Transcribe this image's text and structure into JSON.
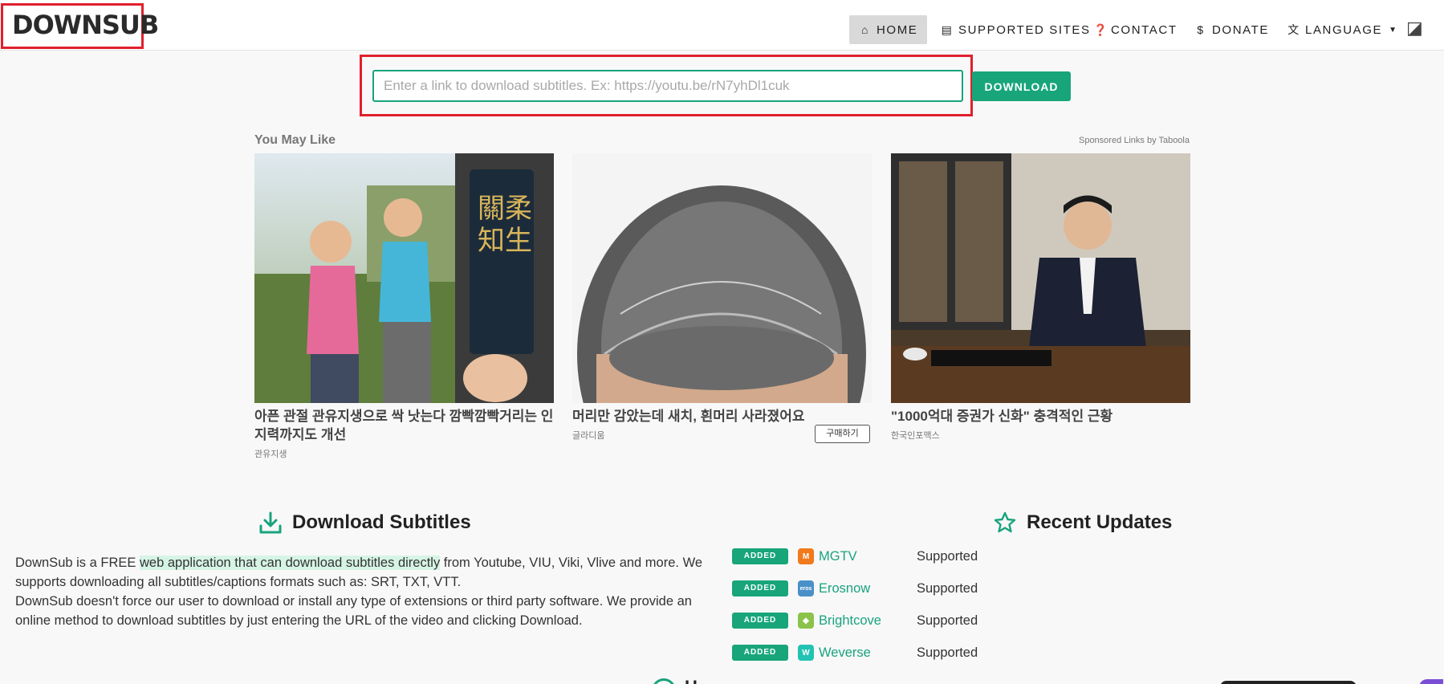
{
  "header": {
    "logo": "DOWNSUB",
    "nav": [
      {
        "label": "HOME",
        "icon": "home-icon",
        "active": true
      },
      {
        "label": "SUPPORTED SITES",
        "icon": "list-icon"
      },
      {
        "label": "CONTACT",
        "icon": "question-icon"
      },
      {
        "label": "DONATE",
        "icon": "dollar-icon"
      },
      {
        "label": "LANGUAGE",
        "icon": "translate-icon"
      }
    ],
    "theme_icon": "theme-toggle-icon"
  },
  "search": {
    "placeholder": "Enter a link to download subtitles. Ex: https://youtu.be/rN7yhDl1cuk",
    "value": "",
    "button": "DOWNLOAD"
  },
  "ads": {
    "title": "You May Like",
    "sponsor": "Sponsored Links by Taboola",
    "items": [
      {
        "headline": "아픈 관절 관유지생으로 싹 낫는다 깜빡깜빡거리는 인지력까지도 개선",
        "source": "관유지생"
      },
      {
        "headline": "머리만 감았는데 새치, 흰머리 사라졌어요",
        "source": "글라디움",
        "button": "구매하기"
      },
      {
        "headline": "\"1000억대 증권가 신화\" 충격적인 근황",
        "source": "한국인포맥스"
      }
    ]
  },
  "download_section": {
    "title": "Download Subtitles",
    "desc_part1": "DownSub is a FREE ",
    "desc_highlight": "web application that can download subtitles directly",
    "desc_part2": " from Youtube, VIU, Viki, Vlive and more. We supports downloading all subtitles/captions formats such as: SRT, TXT, VTT.",
    "desc_line2": "DownSub doesn't force our user to download or install any type of extensions or third party software. We provide an online method to download subtitles by just entering the URL of the video and clicking Download."
  },
  "updates": {
    "title": "Recent Updates",
    "items": [
      {
        "badge": "ADDED",
        "site": "MGTV",
        "status": "Supported",
        "icon_color": "#f07a1c",
        "icon_text": "M"
      },
      {
        "badge": "ADDED",
        "site": "Erosnow",
        "status": "Supported",
        "icon_color": "#4a90c8",
        "icon_text": "eros"
      },
      {
        "badge": "ADDED",
        "site": "Brightcove",
        "status": "Supported",
        "icon_color": "#8bc34a",
        "icon_text": "◆"
      },
      {
        "badge": "ADDED",
        "site": "Weverse",
        "status": "Supported",
        "icon_color": "#22c3b3",
        "icon_text": "W"
      }
    ]
  },
  "bottom": {
    "partial_heading": "H"
  },
  "colors": {
    "accent": "#18a57a",
    "highlight_border": "#e0202c"
  }
}
